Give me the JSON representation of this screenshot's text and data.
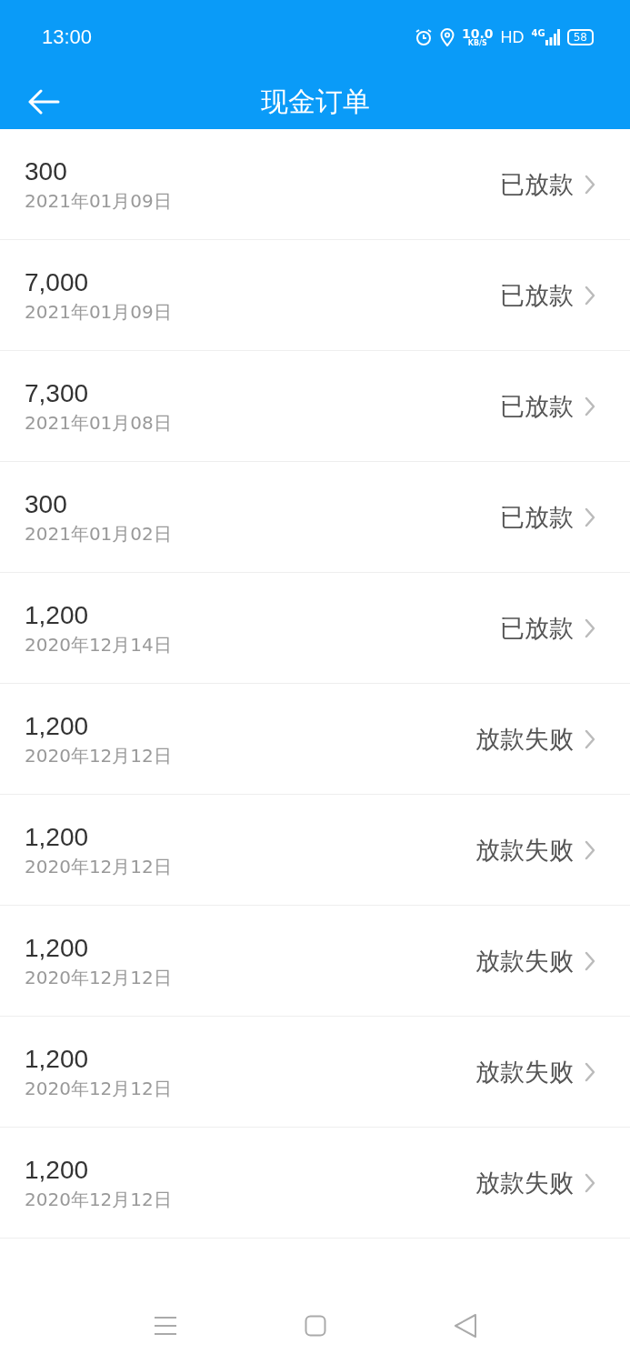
{
  "status_bar": {
    "time": "13:00",
    "speed": "10.0",
    "speed_unit": "KB/S",
    "hd": "HD",
    "network": "4G",
    "battery": "58"
  },
  "header": {
    "title": "现金订单"
  },
  "orders": [
    {
      "amount": "300",
      "date": "2021年01月09日",
      "status": "已放款"
    },
    {
      "amount": "7,000",
      "date": "2021年01月09日",
      "status": "已放款"
    },
    {
      "amount": "7,300",
      "date": "2021年01月08日",
      "status": "已放款"
    },
    {
      "amount": "300",
      "date": "2021年01月02日",
      "status": "已放款"
    },
    {
      "amount": "1,200",
      "date": "2020年12月14日",
      "status": "已放款"
    },
    {
      "amount": "1,200",
      "date": "2020年12月12日",
      "status": "放款失败"
    },
    {
      "amount": "1,200",
      "date": "2020年12月12日",
      "status": "放款失败"
    },
    {
      "amount": "1,200",
      "date": "2020年12月12日",
      "status": "放款失败"
    },
    {
      "amount": "1,200",
      "date": "2020年12月12日",
      "status": "放款失败"
    },
    {
      "amount": "1,200",
      "date": "2020年12月12日",
      "status": "放款失败"
    }
  ]
}
